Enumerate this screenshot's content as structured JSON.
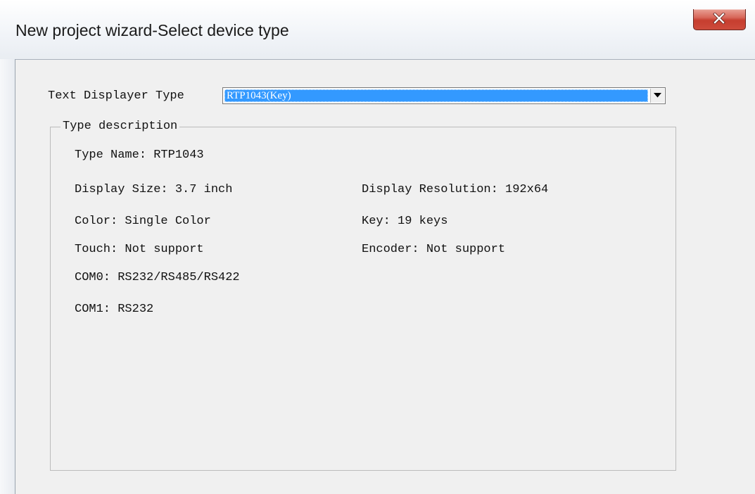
{
  "window": {
    "title": "New project wizard-Select device type"
  },
  "form": {
    "type_label": "Text Displayer Type",
    "selected_type": "RTP1043(Key)"
  },
  "group": {
    "title": "Type description",
    "type_name": "Type Name: RTP1043",
    "display_size": "Display Size: 3.7 inch",
    "display_resolution": "Display Resolution: 192x64",
    "color": "Color: Single Color",
    "key": "Key: 19 keys",
    "touch": "Touch: Not support",
    "encoder": "Encoder: Not support",
    "com0": "COM0: RS232/RS485/RS422",
    "com1": "COM1: RS232"
  },
  "icons": {
    "close": "close-icon",
    "dropdown": "chevron-down-icon"
  },
  "colors": {
    "selection": "#3399ff",
    "close_button": "#c63e2f",
    "dialog_background": "#f0f0f0"
  }
}
